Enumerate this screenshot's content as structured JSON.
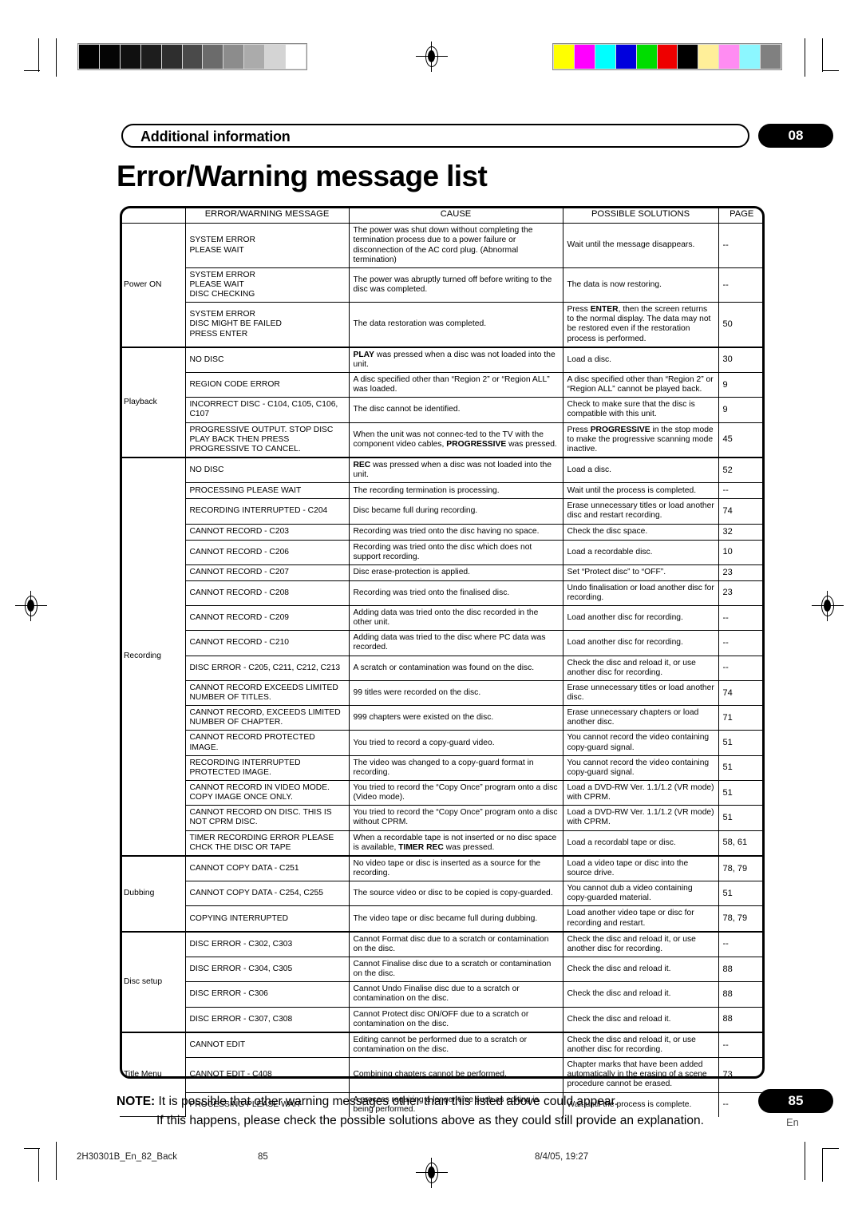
{
  "document": {
    "section_header": "Additional information",
    "chapter_badge": "08",
    "title": "Error/Warning message list",
    "footer_page_badge": "85",
    "footer_language": "En"
  },
  "print_marks": {
    "grayscale_steps": [
      "#000000",
      "#050505",
      "#101010",
      "#1d1d1d",
      "#2e2e2e",
      "#4a4a4a",
      "#6b6b6b",
      "#8c8c8c",
      "#ababab",
      "#d4d4d4",
      "#ffffff"
    ],
    "color_swatches": [
      "#ffff00",
      "#ff00ff",
      "#00ffff",
      "#0000dd",
      "#00dd00",
      "#ee0000",
      "#000000",
      "#ffef99",
      "#ff8cf2",
      "#8cf7ff",
      "#808080"
    ]
  },
  "table": {
    "columns": [
      "",
      "ERROR/WARNING MESSAGE",
      "CAUSE",
      "POSSIBLE SOLUTIONS",
      "PAGE"
    ],
    "groups": [
      {
        "name": "Power ON",
        "rows": [
          {
            "message": "SYSTEM ERROR\nPLEASE WAIT",
            "cause": "The power was shut down without completing the termination process due to a power failure or disconnection of the AC cord plug. (Abnormal termination)",
            "solution": "Wait until the message disappears.",
            "page": "--"
          },
          {
            "message": "SYSTEM ERROR\nPLEASE WAIT\nDISC CHECKING",
            "cause": "The power was abruptly turned off before writing to the disc was completed.",
            "solution": "The data is now restoring.",
            "page": "--"
          },
          {
            "message": "SYSTEM ERROR\nDISC MIGHT BE FAILED\nPRESS ENTER",
            "cause": "The data restoration was completed.",
            "solution_html": "Press <b>ENTER</b>, then the screen returns to the normal display. The data may not be restored even if the restoration process is performed.",
            "page": "50"
          }
        ]
      },
      {
        "name": "Playback",
        "rows": [
          {
            "message": "NO DISC",
            "cause_html": "<b>PLAY</b> was pressed when a disc was not loaded into the unit.",
            "solution": "Load a disc.",
            "page": "30"
          },
          {
            "message": "REGION CODE ERROR",
            "cause": "A disc specified other than “Region 2” or “Region ALL” was loaded.",
            "solution": "A disc specified other than “Region 2” or “Region ALL” cannot be played back.",
            "page": "9"
          },
          {
            "message": "INCORRECT DISC - C104, C105, C106, C107",
            "message_justify": true,
            "cause": "The disc cannot be identified.",
            "solution": "Check to make sure that the disc is compatible with this unit.",
            "page": "9"
          },
          {
            "message": "PROGRESSIVE OUTPUT. STOP DISC PLAY BACK THEN PRESS PROGRESSIVE TO CANCEL.",
            "message_justify": true,
            "cause_html": "When the unit was not connec-ted to the TV with the component video cables, <b>PROGRESSIVE</b> was pressed.",
            "solution_html": "Press <b>PROGRESSIVE</b> in the stop mode to make the progressive scanning mode inactive.",
            "page": "45"
          }
        ]
      },
      {
        "name": "Recording",
        "rows": [
          {
            "message": "NO DISC",
            "cause_html": "<b>REC</b> was pressed when a disc was not loaded into the unit.",
            "solution": "Load a disc.",
            "page": "52"
          },
          {
            "message": "PROCESSING PLEASE WAIT",
            "cause": "The recording termination is processing.",
            "solution": "Wait until the process is completed.",
            "page": "--"
          },
          {
            "message": "RECORDING INTERRUPTED - C204",
            "message_justify": true,
            "cause": "Disc became full during recording.",
            "solution": "Erase unnecessary titles or load another disc and restart recording.",
            "page": "74"
          },
          {
            "message": "CANNOT RECORD  - C203",
            "cause": "Recording was tried onto the disc having no space.",
            "solution": "Check the disc space.",
            "page": "32"
          },
          {
            "message": "CANNOT RECORD  - C206",
            "cause": "Recording was tried onto the disc which does not support recording.",
            "solution": "Load a recordable disc.",
            "page": "10"
          },
          {
            "message": "CANNOT RECORD  - C207",
            "cause": "Disc erase-protection is applied.",
            "solution": "Set “Protect disc” to “OFF”.",
            "page": "23"
          },
          {
            "message": "CANNOT RECORD  - C208",
            "cause": "Recording was tried onto the finalised disc.",
            "solution": "Undo finalisation or load another disc for recording.",
            "page": "23"
          },
          {
            "message": "CANNOT RECORD  - C209",
            "cause": "Adding data was tried onto the disc recorded in the other unit.",
            "solution": "Load another disc for recording.",
            "page": "--"
          },
          {
            "message": "CANNOT RECORD  - C210",
            "cause": "Adding data was tried to the disc where PC data was recorded.",
            "solution": "Load another disc for recording.",
            "page": "--"
          },
          {
            "message": "DISC ERROR - C205, C211, C212, C213",
            "cause": "A scratch or contamination was found on the disc.",
            "solution": "Check the disc and reload it, or use another disc for recording.",
            "page": "--"
          },
          {
            "message": "CANNOT RECORD EXCEEDS LIMITED NUMBER OF TITLES.",
            "cause": "99 titles were recorded on the disc.",
            "solution": "Erase unnecessary titles or load another disc.",
            "page": "74"
          },
          {
            "message": "CANNOT RECORD, EXCEEDS LIMITED NUMBER OF CHAPTER.",
            "message_justify": true,
            "cause": "999 chapters were existed on the disc.",
            "solution": "Erase unnecessary chapters or load another disc.",
            "page": "71"
          },
          {
            "message": "CANNOT RECORD PROTECTED IMAGE.",
            "message_justify": true,
            "cause": "You tried to record a copy-guard video.",
            "solution": "You cannot record the video containing copy-guard signal.",
            "page": "51"
          },
          {
            "message": "RECORDING INTERRUPTED PROTECTED IMAGE.",
            "cause": "The video was changed to a copy-guard format in recording.",
            "solution": "You cannot record the video containing copy-guard signal.",
            "page": "51"
          },
          {
            "message": "CANNOT RECORD IN VIDEO MODE. COPY IMAGE ONCE ONLY.",
            "cause": "You tried to record the “Copy Once” program onto a disc (Video mode).",
            "solution": "Load a DVD-RW Ver. 1.1/1.2 (VR mode) with CPRM.",
            "page": "51"
          },
          {
            "message": "CANNOT RECORD ON DISC. THIS IS NOT CPRM DISC.",
            "message_justify": true,
            "cause": "You tried to record the “Copy Once” program onto a disc without CPRM.",
            "solution": "Load a DVD-RW Ver. 1.1/1.2 (VR mode) with CPRM.",
            "page": "51"
          },
          {
            "message": "TIMER RECORDING ERROR PLEASE CHCK THE DISC OR TAPE",
            "message_justify": true,
            "cause_html": "When a recordable tape is not inserted or no disc space is available, <b>TIMER REC</b> was pressed.",
            "solution": "Load a recordabl tape or disc.",
            "page": "58, 61"
          }
        ]
      },
      {
        "name": "Dubbing",
        "rows": [
          {
            "message": "CANNOT COPY DATA - C251",
            "cause": "No video tape or disc is inserted as a source for the recording.",
            "solution": "Load a video tape or disc into the source drive.",
            "page": "78, 79"
          },
          {
            "message": "CANNOT COPY DATA - C254, C255",
            "cause": "The source video or disc to be copied is copy-guarded.",
            "solution": "You cannot dub a video containing copy-guarded material.",
            "page": "51"
          },
          {
            "message": "COPYING INTERRUPTED",
            "cause": "The video tape or disc became full during dubbing.",
            "solution": "Load another video tape or disc for recording and restart.",
            "page": "78, 79"
          }
        ]
      },
      {
        "name": "Disc setup",
        "rows": [
          {
            "message": "DISC ERROR - C302, C303",
            "cause": "Cannot Format disc due to a scratch or contamination on the disc.",
            "solution": "Check the disc and reload it, or use another disc for recording.",
            "page": "--"
          },
          {
            "message": "DISC ERROR - C304, C305",
            "cause": "Cannot Finalise disc due to a scratch or contamination on the disc.",
            "solution": "Check the disc and reload it.",
            "page": "88"
          },
          {
            "message": "DISC ERROR - C306",
            "cause": "Cannot Undo Finalise disc due to a scratch or contamination on the disc.",
            "solution": "Check the disc and reload it.",
            "page": "88"
          },
          {
            "message": "DISC ERROR - C307, C308",
            "cause": "Cannot Protect disc ON/OFF due to a scratch or contamination on the disc.",
            "solution": "Check the disc and reload it.",
            "page": "88"
          }
        ]
      },
      {
        "name": "Title Menu",
        "rows": [
          {
            "message": "CANNOT EDIT",
            "cause": "Editing cannot be performed due to a scratch or contamination on the disc.",
            "solution": "Check the disc and reload it, or use another disc for recording.",
            "page": "--"
          },
          {
            "message": "CANNOT EDIT - C408",
            "cause": "Combining chapters cannot be performed.",
            "solution": "Chapter marks that have been added automatically in the erasing of a scene procedure cannot be erased.",
            "solution_justify": true,
            "page": "73"
          },
          {
            "message": "PROCESSING PLEASE WAIT",
            "cause": "A process requiring a longer time such as editing is being performed.",
            "solution": "Wait until the process is complete.",
            "page": "--"
          }
        ]
      }
    ]
  },
  "note": {
    "label": "NOTE:",
    "line1": "It is possible that other warning messages other than this listed above could appear.",
    "line2": "If this happens, please check the possible solutions above as they could still provide an explanation."
  },
  "print_footer": {
    "job_id": "2H30301B_En_82_Back",
    "page_number": "85",
    "timestamp": "8/4/05, 19:27"
  }
}
